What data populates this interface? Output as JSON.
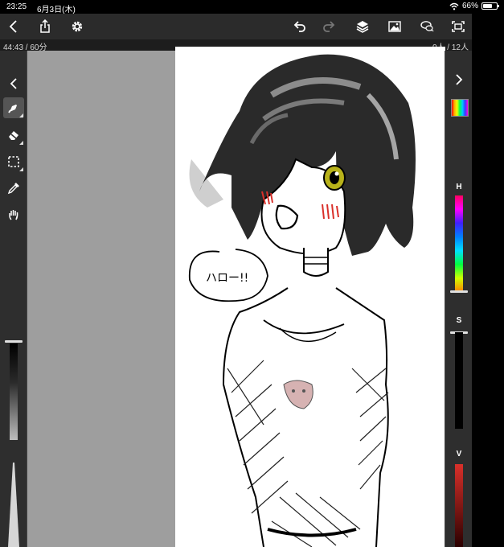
{
  "status": {
    "time": "23:25",
    "date": "6月3日(木)",
    "battery": "66%",
    "battery_level": 0.66
  },
  "toolbar": {
    "icons": [
      "back-icon",
      "share-icon",
      "settings-icon",
      "undo-icon",
      "redo-icon",
      "layers-icon",
      "image-icon",
      "chat-icon",
      "fullscreen-icon"
    ]
  },
  "info": {
    "elapsed": "44:43 / 60分",
    "viewers": "0人 / 12人"
  },
  "tools": [
    "brush-icon",
    "eraser-icon",
    "selection-icon",
    "eyedropper-icon",
    "hand-icon"
  ],
  "color_panel": {
    "hue_label": "H",
    "sat_label": "S",
    "val_label": "V",
    "accent": "#d9302a",
    "hue_level": 0.98,
    "sat_level": 0.02
  },
  "canvas": {
    "speech_text": "ハロー!!"
  }
}
